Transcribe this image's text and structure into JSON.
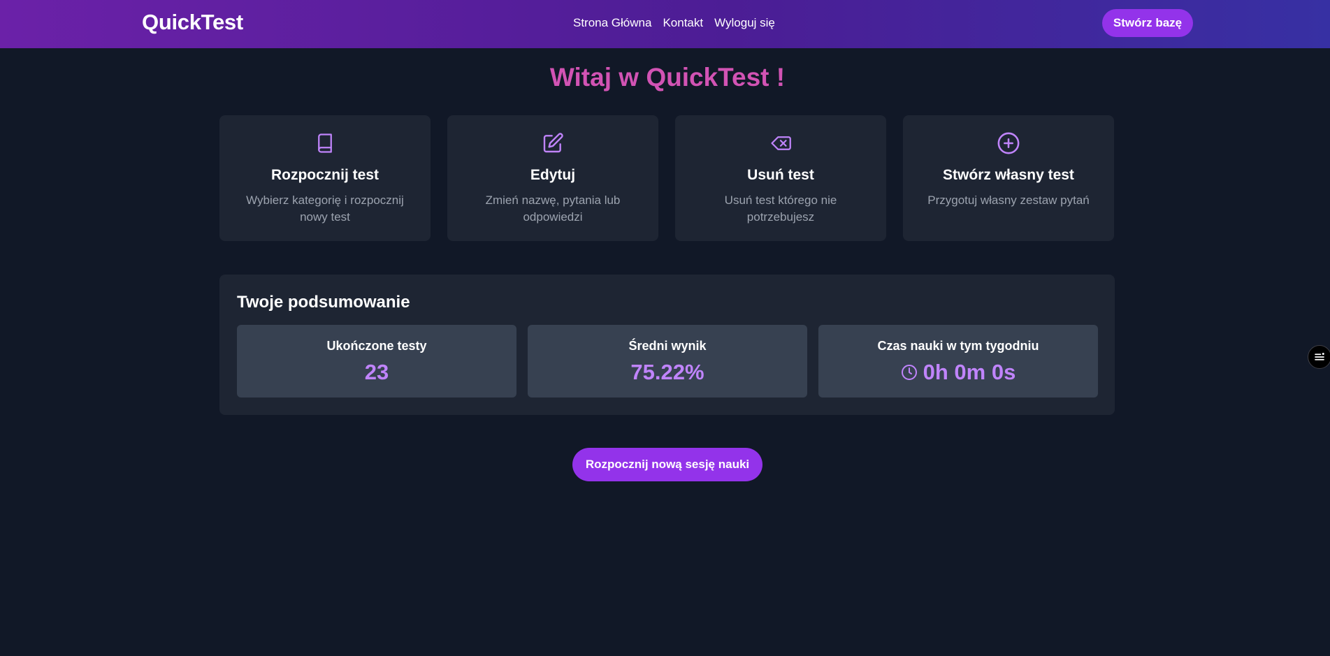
{
  "navbar": {
    "brand": "QuickTest",
    "links": [
      {
        "label": "Strona Główna"
      },
      {
        "label": "Kontakt"
      },
      {
        "label": "Wyloguj się"
      }
    ],
    "create_db_label": "Stwórz bazę"
  },
  "welcome": "Witaj w QuickTest !",
  "cards": [
    {
      "icon": "book-icon",
      "title": "Rozpocznij test",
      "desc": "Wybierz kategorię i rozpocznij nowy test"
    },
    {
      "icon": "edit-icon",
      "title": "Edytuj",
      "desc": "Zmień nazwę, pytania lub odpowiedzi"
    },
    {
      "icon": "delete-icon",
      "title": "Usuń test",
      "desc": "Usuń test którego nie potrzebujesz"
    },
    {
      "icon": "plus-circle-icon",
      "title": "Stwórz własny test",
      "desc": "Przygotuj własny zestaw pytań"
    }
  ],
  "summary": {
    "title": "Twoje podsumowanie",
    "stats": [
      {
        "label": "Ukończone testy",
        "value": "23"
      },
      {
        "label": "Średni wynik",
        "value": "75.22%"
      },
      {
        "label": "Czas nauki w tym tygodniu",
        "value": "0h 0m 0s",
        "icon": "clock-icon"
      }
    ]
  },
  "session_button": "Rozpocznij nową sesję nauki",
  "colors": {
    "background": "#111827",
    "card": "#1e2533",
    "stat": "#374151",
    "accent": "#9333ea",
    "accent_text": "#c084fc",
    "heading": "#d253b4",
    "navbar_gradient": [
      "#6b21a8",
      "#3730a3"
    ]
  }
}
